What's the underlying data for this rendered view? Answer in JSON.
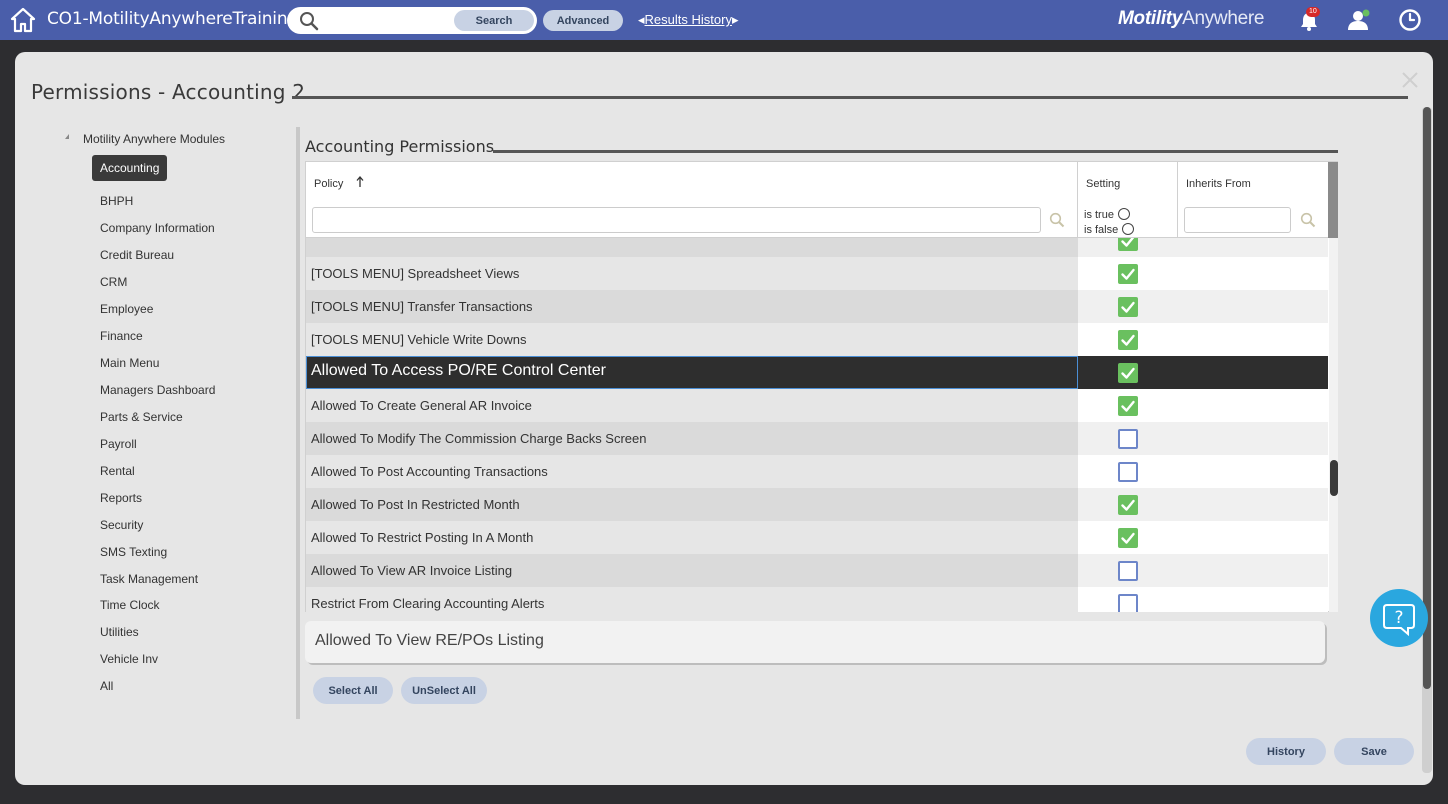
{
  "header": {
    "app_title": "CO1-MotilityAnywhereTraining",
    "search_placeholder": "",
    "search_label": "Search",
    "advanced_label": "Advanced",
    "results_history_label": "Results History",
    "brand_bold": "Motility",
    "brand_light": "Anywhere",
    "notification_count": "10",
    "bar_color": "#4a5eaa"
  },
  "modal": {
    "title": "Permissions - Accounting 2"
  },
  "tree": {
    "root_label": "Motility Anywhere Modules",
    "items": [
      "Accounting",
      "BHPH",
      "Company Information",
      "Credit Bureau",
      "CRM",
      "Employee",
      "Finance",
      "Main Menu",
      "Managers Dashboard",
      "Parts & Service",
      "Payroll",
      "Rental",
      "Reports",
      "Security",
      "SMS Texting",
      "Task Management",
      "Time Clock",
      "Utilities",
      "Vehicle Inv",
      "All"
    ],
    "active": "Accounting"
  },
  "permissions": {
    "section_title": "Accounting Permissions",
    "columns": {
      "policy": "Policy",
      "setting": "Setting",
      "inherits_from": "Inherits From"
    },
    "filter": {
      "is_true": "is true",
      "is_false": "is false"
    },
    "rows": [
      {
        "policy": "",
        "checked": true
      },
      {
        "policy": "[TOOLS MENU] Spreadsheet Views",
        "checked": true
      },
      {
        "policy": "[TOOLS MENU] Transfer Transactions",
        "checked": true
      },
      {
        "policy": "[TOOLS MENU] Vehicle Write Downs",
        "checked": true
      },
      {
        "policy": "Allowed To Access PO/RE Control Center",
        "checked": true,
        "selected": true
      },
      {
        "policy": "Allowed To Create General AR Invoice",
        "checked": true
      },
      {
        "policy": "Allowed To Modify The Commission Charge Backs Screen",
        "checked": false
      },
      {
        "policy": "Allowed To Post Accounting Transactions",
        "checked": false
      },
      {
        "policy": "Allowed To Post In Restricted Month",
        "checked": true
      },
      {
        "policy": "Allowed To Restrict Posting In A Month",
        "checked": true
      },
      {
        "policy": "Allowed To View AR Invoice Listing",
        "checked": false
      },
      {
        "policy": "Restrict From Clearing Accounting Alerts",
        "checked": false
      }
    ],
    "description": "Allowed To View RE/POs Listing",
    "select_all_label": "Select All",
    "unselect_all_label": "UnSelect All"
  },
  "footer": {
    "history_label": "History",
    "save_label": "Save"
  },
  "colors": {
    "checked": "#6ac05f",
    "unchecked_border": "#6d86c9",
    "help_button": "#2aa7df"
  }
}
